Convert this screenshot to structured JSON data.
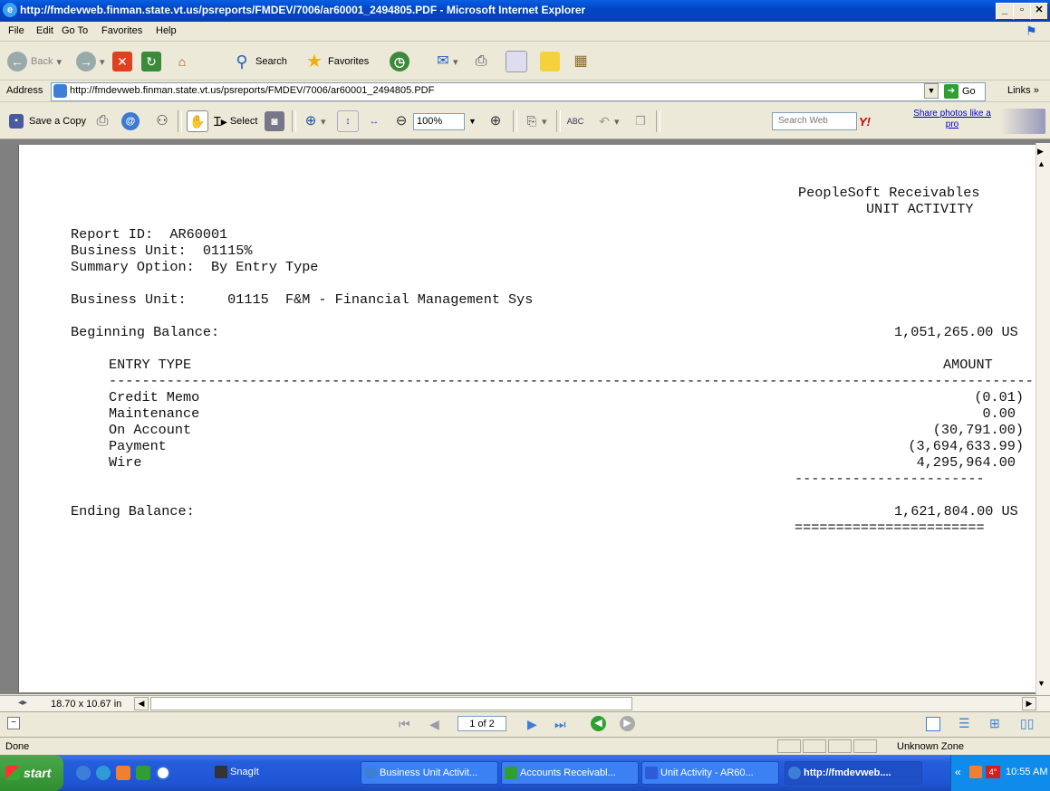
{
  "window": {
    "title": "http://fmdevweb.finman.state.vt.us/psreports/FMDEV/7006/ar60001_2494805.PDF - Microsoft Internet Explorer"
  },
  "menu": [
    "File",
    "Edit",
    "Go To",
    "Favorites",
    "Help"
  ],
  "toolbar": {
    "back": "Back",
    "search": "Search",
    "favorites": "Favorites"
  },
  "address": {
    "label": "Address",
    "url": "http://fmdevweb.finman.state.vt.us/psreports/FMDEV/7006/ar60001_2494805.PDF",
    "go": "Go",
    "links": "Links"
  },
  "acrobat": {
    "save_copy": "Save a Copy",
    "select": "Select",
    "zoom": "100%",
    "search_placeholder": "Search Web",
    "share": "Share photos like a",
    "share2": "pro"
  },
  "report": {
    "header_right_1": "PeopleSoft Receivables",
    "header_right_2": "UNIT ACTIVITY",
    "report_id": "Report ID:  AR60001",
    "business_unit": "Business Unit:  01115%",
    "summary_option": "Summary Option:  By Entry Type",
    "bu_line": "Business Unit:     01115  F&M - Financial Management Sys",
    "beginning_label": "Beginning Balance:",
    "beginning_value": "1,051,265.00 US",
    "col_entry_type": "ENTRY TYPE",
    "col_amount": "AMOUNT",
    "dash_line": "----------------------------------------------------------------------------------------------------------------",
    "rows": [
      {
        "type": "Credit Memo",
        "amount": "(0.01)"
      },
      {
        "type": "Maintenance",
        "amount": "0.00"
      },
      {
        "type": "On Account",
        "amount": "(30,791.00)"
      },
      {
        "type": "Payment",
        "amount": "(3,694,633.99)"
      },
      {
        "type": "Wire",
        "amount": "4,295,964.00"
      }
    ],
    "subtotal_line": "-----------------------",
    "ending_label": "Ending Balance:",
    "ending_value": "1,621,804.00 US",
    "double_line": "======================="
  },
  "hscroll": {
    "page_size": "18.70 x 10.67 in"
  },
  "nav": {
    "page_indicator": "1 of 2"
  },
  "status": {
    "left": "Done",
    "zone": "Unknown Zone"
  },
  "taskbar": {
    "start": "start",
    "snagit": "SnagIt",
    "tasks": [
      "Business Unit Activit...",
      "Accounts Receivabl...",
      "Unit Activity - AR60...",
      "http://fmdevweb...."
    ],
    "temp": "4°",
    "clock": "10:55 AM"
  }
}
